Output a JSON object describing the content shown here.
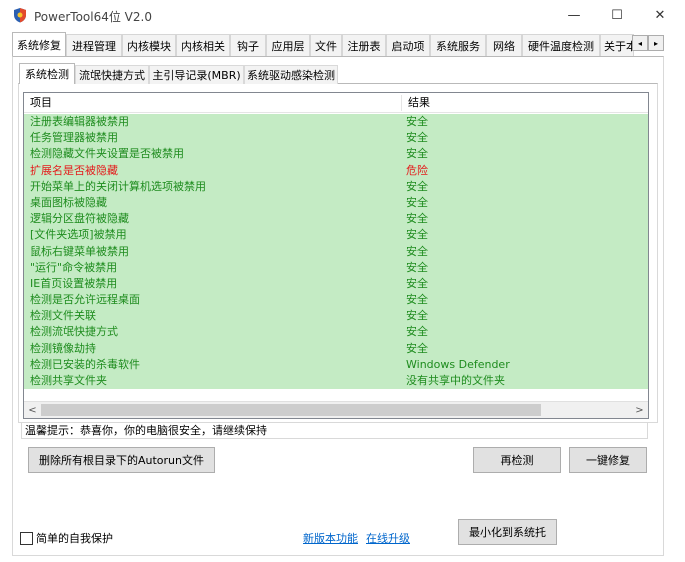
{
  "window": {
    "title": "PowerTool64位 V2.0",
    "controls": {
      "minimize": "—",
      "maximize": "☐",
      "close": "✕"
    }
  },
  "main_tabs": [
    {
      "label": "系统修复",
      "active": true
    },
    {
      "label": "进程管理"
    },
    {
      "label": "内核模块"
    },
    {
      "label": "内核相关"
    },
    {
      "label": "钩子"
    },
    {
      "label": "应用层"
    },
    {
      "label": "文件"
    },
    {
      "label": "注册表"
    },
    {
      "label": "启动项"
    },
    {
      "label": "系统服务"
    },
    {
      "label": "网络"
    },
    {
      "label": "硬件温度检测"
    },
    {
      "label": "关于本"
    }
  ],
  "tab_scroll": {
    "left": "◂",
    "right": "▸"
  },
  "sub_tabs": [
    {
      "label": "系统检测",
      "active": true
    },
    {
      "label": "流氓快捷方式"
    },
    {
      "label": "主引导记录(MBR)"
    },
    {
      "label": "系统驱动感染检测"
    }
  ],
  "list": {
    "columns": [
      "项目",
      "结果"
    ],
    "rows": [
      {
        "item": "注册表编辑器被禁用",
        "result": "安全",
        "status": "safe"
      },
      {
        "item": "任务管理器被禁用",
        "result": "安全",
        "status": "safe"
      },
      {
        "item": "检测隐藏文件夹设置是否被禁用",
        "result": "安全",
        "status": "safe"
      },
      {
        "item": "扩展名是否被隐藏",
        "result": "危险",
        "status": "danger"
      },
      {
        "item": "开始菜单上的关闭计算机选项被禁用",
        "result": "安全",
        "status": "safe"
      },
      {
        "item": "桌面图标被隐藏",
        "result": "安全",
        "status": "safe"
      },
      {
        "item": "逻辑分区盘符被隐藏",
        "result": "安全",
        "status": "safe"
      },
      {
        "item": "[文件夹选项]被禁用",
        "result": "安全",
        "status": "safe"
      },
      {
        "item": "鼠标右键菜单被禁用",
        "result": "安全",
        "status": "safe"
      },
      {
        "item": "\"运行\"命令被禁用",
        "result": "安全",
        "status": "safe"
      },
      {
        "item": "IE首页设置被禁用",
        "result": "安全",
        "status": "safe"
      },
      {
        "item": "检测是否允许远程桌面",
        "result": "安全",
        "status": "safe"
      },
      {
        "item": "检测文件关联",
        "result": "安全",
        "status": "safe"
      },
      {
        "item": "检测流氓快捷方式",
        "result": "安全",
        "status": "safe"
      },
      {
        "item": "检测镜像劫持",
        "result": "安全",
        "status": "safe"
      },
      {
        "item": "检测已安装的杀毒软件",
        "result": "Windows Defender",
        "status": "safe"
      },
      {
        "item": "检测共享文件夹",
        "result": "没有共享中的文件夹",
        "status": "safe"
      }
    ],
    "scroll_left": "<",
    "scroll_right": ">"
  },
  "tip": "温馨提示：恭喜你，你的电脑很安全，请继续保持",
  "buttons": {
    "delete_autorun": "删除所有根目录下的Autorun文件",
    "recheck": "再检测",
    "one_click_fix": "一键修复",
    "minimize_tray": "最小化到系统托"
  },
  "footer": {
    "self_protect": "简单的自我保护",
    "new_features_link": "新版本功能",
    "online_upgrade_link": "在线升级"
  },
  "colors": {
    "row_bg": "#c4ebc4",
    "safe_text": "#1e8c1e",
    "danger_text": "#e41b1b",
    "link": "#0066cc"
  }
}
